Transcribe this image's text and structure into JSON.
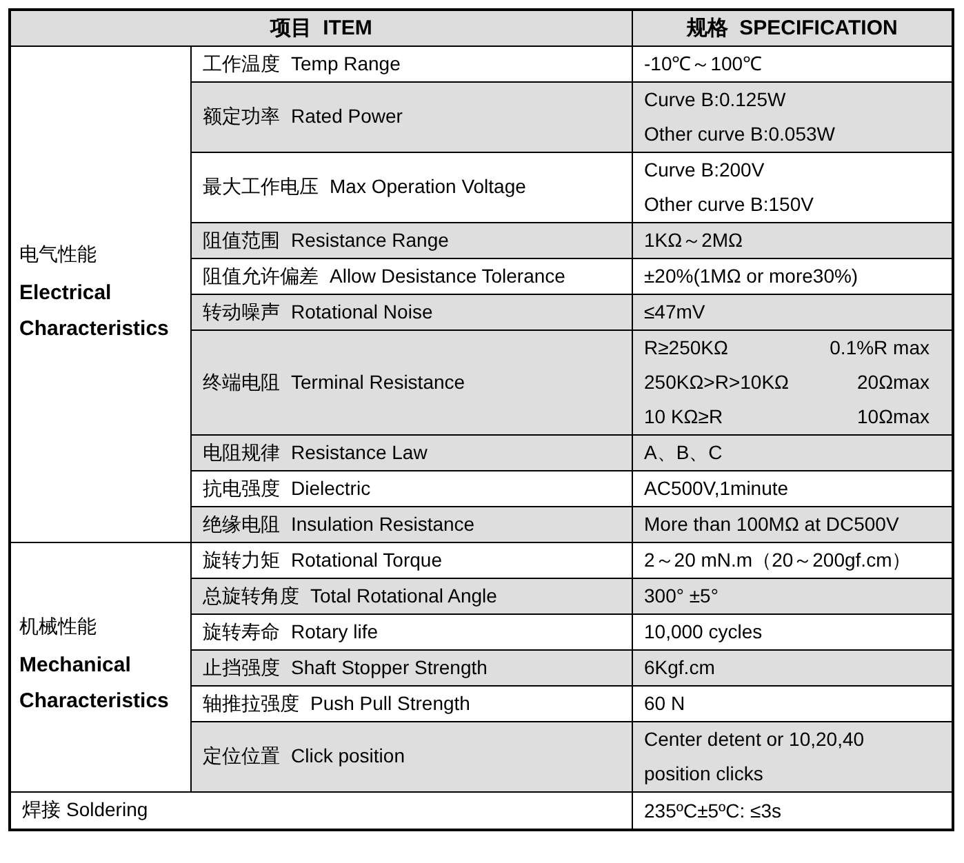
{
  "header": {
    "item": {
      "cn": "项目",
      "en": "ITEM"
    },
    "spec": {
      "cn": "规格",
      "en": "SPECIFICATION"
    }
  },
  "sections": [
    {
      "cn": "电气性能",
      "en": "Electrical Characteristics",
      "rows": [
        {
          "cn": "工作温度",
          "en": "Temp Range",
          "shaded": false,
          "spec": [
            {
              "text": "-10℃～100℃"
            }
          ]
        },
        {
          "cn": "额定功率",
          "en": "Rated Power",
          "shaded": true,
          "spec": [
            {
              "text": "Curve B:0.125W"
            },
            {
              "text": "Other curve B:0.053W"
            }
          ]
        },
        {
          "cn": "最大工作电压",
          "en": "Max Operation Voltage",
          "shaded": false,
          "spec": [
            {
              "text": "Curve B:200V"
            },
            {
              "text": "Other curve B:150V"
            }
          ]
        },
        {
          "cn": "阻值范围",
          "en": "Resistance Range",
          "shaded": true,
          "spec": [
            {
              "text": "1KΩ～2MΩ"
            }
          ]
        },
        {
          "cn": "阻值允许偏差",
          "en": "Allow Desistance Tolerance",
          "shaded": false,
          "spec": [
            {
              "text": "±20%(1MΩ  or more30%)"
            }
          ]
        },
        {
          "cn": "转动噪声",
          "en": "Rotational Noise",
          "shaded": true,
          "spec": [
            {
              "text": "≤47mV"
            }
          ]
        },
        {
          "cn": "终端电阻",
          "en": "Terminal Resistance",
          "shaded": true,
          "spec": [
            {
              "text": "R≥250KΩ",
              "value": "0.1%R max"
            },
            {
              "text": "250KΩ>R>10KΩ",
              "value": "20Ωmax"
            },
            {
              "text": "10 KΩ≥R",
              "value": "10Ωmax"
            }
          ]
        },
        {
          "cn": "电阻规律",
          "en": "Resistance Law",
          "shaded": true,
          "spec": [
            {
              "text": "A、B、C"
            }
          ]
        },
        {
          "cn": "抗电强度",
          "en": "Dielectric",
          "shaded": false,
          "spec": [
            {
              "text": "AC500V,1minute"
            }
          ]
        },
        {
          "cn": "绝缘电阻",
          "en": "Insulation  Resistance",
          "shaded": true,
          "spec": [
            {
              "text": "More than 100MΩ  at DC500V"
            }
          ]
        }
      ]
    },
    {
      "cn": "机械性能",
      "en": "Mechanical Characteristics",
      "rows": [
        {
          "cn": "旋转力矩",
          "en": "Rotational Torque",
          "shaded": false,
          "spec": [
            {
              "text": "2～20 mN.m（20～200gf.cm）"
            }
          ]
        },
        {
          "cn": "总旋转角度",
          "en": "Total Rotational Angle",
          "shaded": true,
          "spec": [
            {
              "text": "300°  ±5°"
            }
          ]
        },
        {
          "cn": "旋转寿命",
          "en": "Rotary life",
          "shaded": false,
          "spec": [
            {
              "text": "10,000 cycles"
            }
          ]
        },
        {
          "cn": "止挡强度",
          "en": "Shaft Stopper Strength",
          "shaded": true,
          "spec": [
            {
              "text": "6Kgf.cm"
            }
          ]
        },
        {
          "cn": "轴推拉强度",
          "en": "Push Pull Strength",
          "shaded": false,
          "spec": [
            {
              "text": "60 N"
            }
          ]
        },
        {
          "cn": "定位位置",
          "en": "Click position",
          "shaded": true,
          "spec": [
            {
              "text": "Center detent or 10,20,40"
            },
            {
              "text": "position clicks"
            }
          ]
        }
      ]
    }
  ],
  "footer": {
    "cn": "焊接",
    "en": "Soldering",
    "spec": "235ºC±5ºC: ≤3s"
  }
}
